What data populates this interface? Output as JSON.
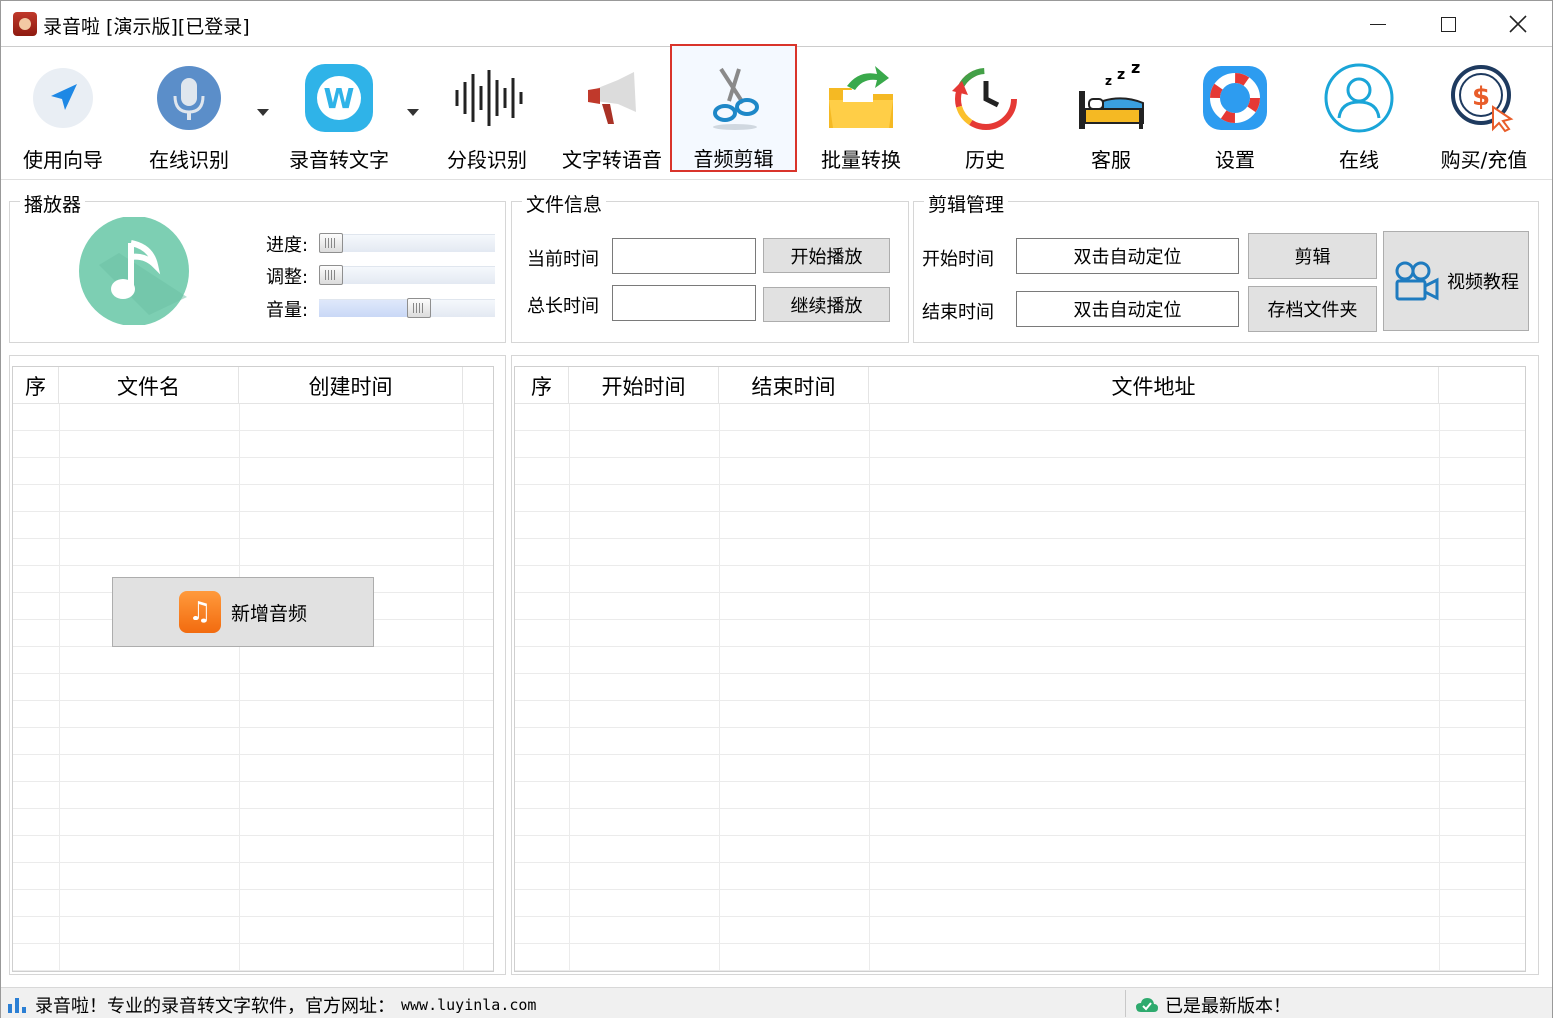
{
  "window": {
    "title": "录音啦 [演示版][已登录]"
  },
  "toolbar": {
    "items": [
      {
        "label": "使用向导",
        "icon": "navigation-arrow-icon"
      },
      {
        "label": "在线识别",
        "icon": "microphone-icon"
      },
      {
        "label": "录音转文字",
        "icon": "w-logo-icon"
      },
      {
        "label": "分段识别",
        "icon": "waveform-icon"
      },
      {
        "label": "文字转语音",
        "icon": "megaphone-icon"
      },
      {
        "label": "音频剪辑",
        "icon": "scissors-icon"
      },
      {
        "label": "批量转换",
        "icon": "folder-arrow-icon"
      },
      {
        "label": "历史",
        "icon": "history-clock-icon"
      },
      {
        "label": "客服",
        "icon": "sleeping-bed-icon"
      },
      {
        "label": "设置",
        "icon": "lifebuoy-icon"
      },
      {
        "label": "在线",
        "icon": "user-circle-icon"
      },
      {
        "label": "购买/充值",
        "icon": "dollar-coin-icon"
      }
    ],
    "active": "音频剪辑"
  },
  "player": {
    "title": "播放器",
    "progress_label": "进度:",
    "adjust_label": "调整:",
    "volume_label": "音量:",
    "progress_value": 0.0,
    "adjust_value": 0.0,
    "volume_value": 0.58
  },
  "file_info": {
    "title": "文件信息",
    "current_time_label": "当前时间",
    "current_time_value": "",
    "total_time_label": "总长时间",
    "total_time_value": "",
    "start_play_button": "开始播放",
    "resume_play_button": "继续播放"
  },
  "clip_manage": {
    "title": "剪辑管理",
    "start_time_label": "开始时间",
    "start_time_value": "双击自动定位",
    "end_time_label": "结束时间",
    "end_time_value": "双击自动定位",
    "clip_button": "剪辑",
    "archive_button": "存档文件夹",
    "video_tutorial_button": "视频教程"
  },
  "file_table": {
    "headers": [
      "序",
      "文件名",
      "创建时间"
    ],
    "rows": []
  },
  "clip_table": {
    "headers": [
      "序",
      "开始时间",
      "结束时间",
      "文件地址"
    ],
    "rows": []
  },
  "add_audio_button": "新增音频",
  "status": {
    "left_text": "录音啦！专业的录音转文字软件，官方网址：",
    "url": "www.luyinla.com",
    "right_text": "已是最新版本！"
  },
  "colors": {
    "active_border": "#d9342b",
    "player_icon": "#7dcfb3",
    "add_audio_icon": "#f26b0f"
  }
}
